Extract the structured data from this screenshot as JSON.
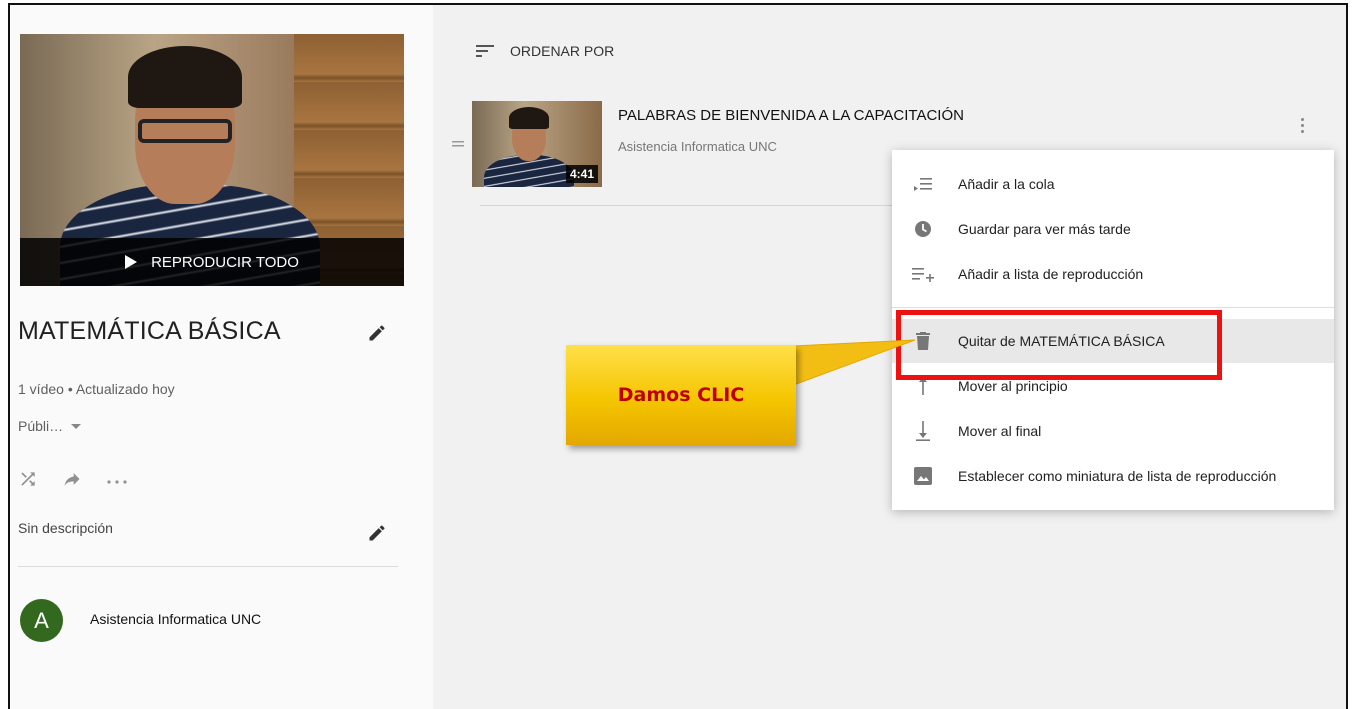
{
  "sidebar": {
    "play_all_label": "REPRODUCIR TODO",
    "playlist_title": "MATEMÁTICA BÁSICA",
    "meta": "1 vídeo • Actualizado hoy",
    "privacy": "Públi…",
    "description": "Sin descripción",
    "owner_initial": "A",
    "owner_name": "Asistencia Informatica UNC"
  },
  "main": {
    "sort_label": "ORDENAR POR",
    "video": {
      "title": "PALABRAS DE BIENVENIDA A LA CAPACITACIÓN",
      "channel": "Asistencia Informatica UNC",
      "duration": "4:41"
    }
  },
  "menu": {
    "items": [
      {
        "label": "Añadir a la cola",
        "icon": "queue-icon"
      },
      {
        "label": "Guardar para ver más tarde",
        "icon": "clock-icon"
      },
      {
        "label": "Añadir a lista de reproducción",
        "icon": "playlist-add-icon"
      },
      {
        "label": "Quitar de MATEMÁTICA BÁSICA",
        "icon": "trash-icon"
      },
      {
        "label": "Mover al principio",
        "icon": "arrow-up-icon"
      },
      {
        "label": "Mover al final",
        "icon": "arrow-down-icon"
      },
      {
        "label": "Establecer como miniatura de lista de reproducción",
        "icon": "image-icon"
      }
    ]
  },
  "annotation": {
    "callout_text": "Damos CLIC",
    "highlight_color": "#ee1111",
    "callout_text_color": "#c00000"
  }
}
